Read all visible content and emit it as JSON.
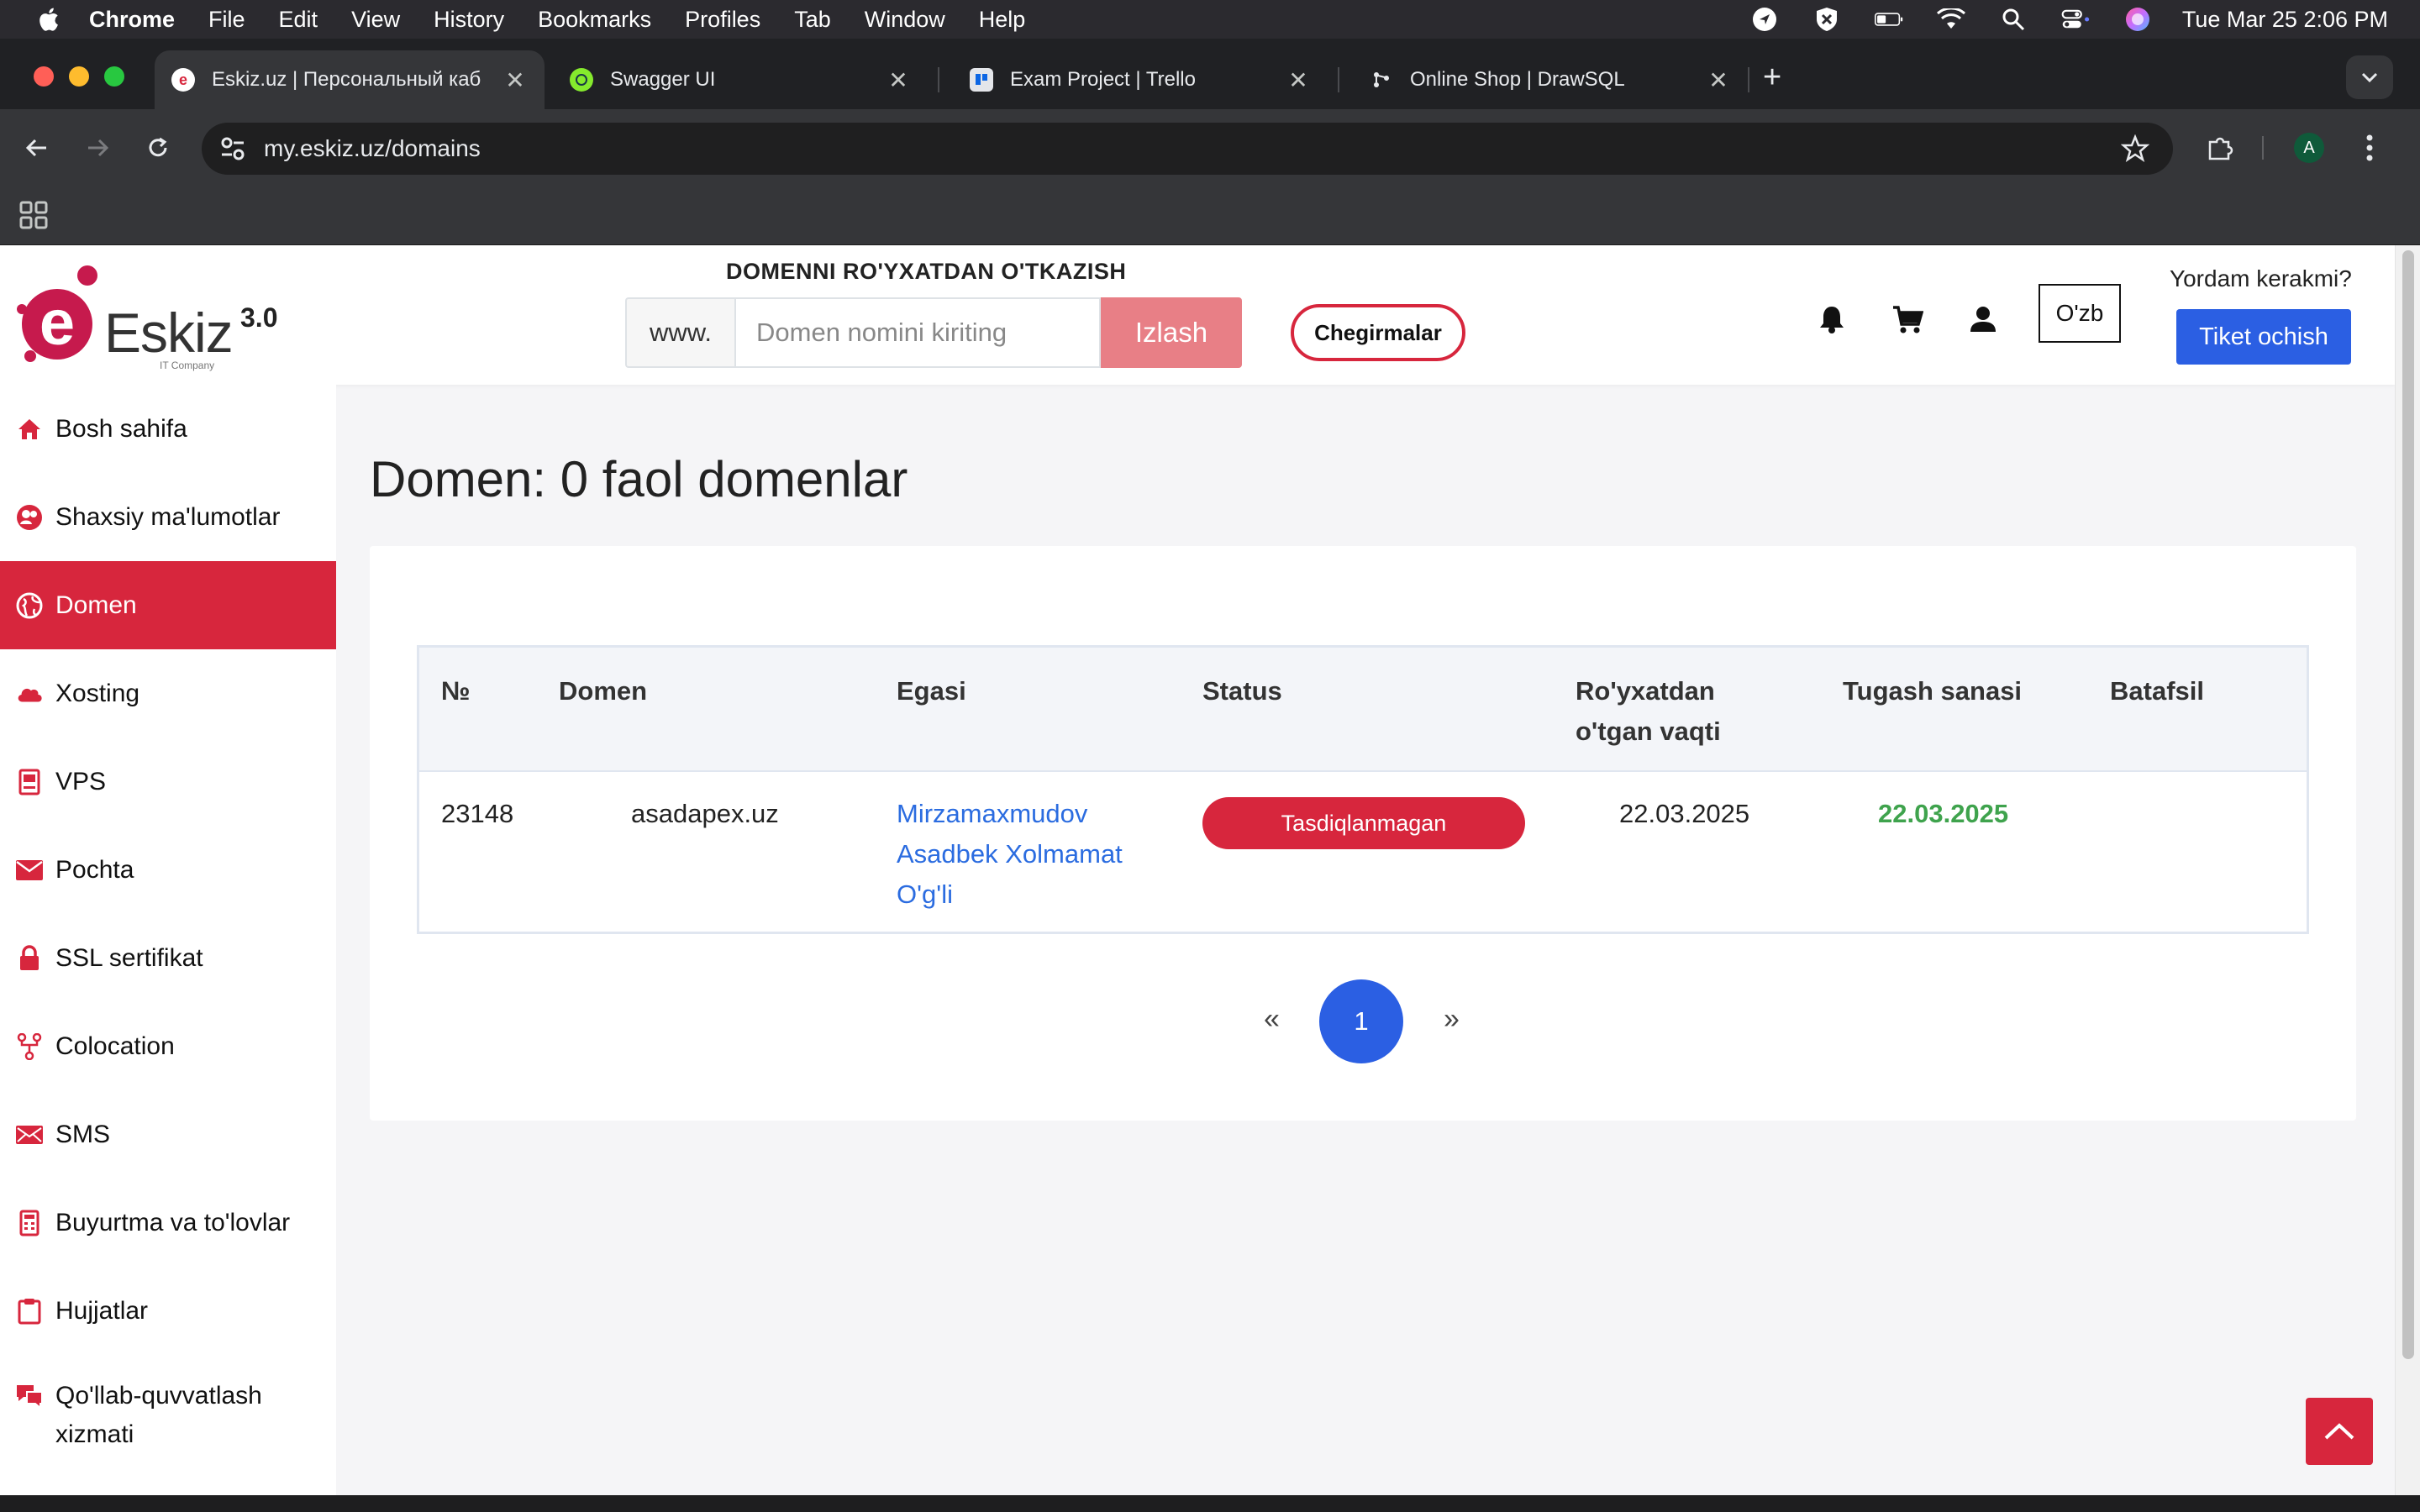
{
  "menubar": {
    "app": "Chrome",
    "items": [
      "File",
      "Edit",
      "View",
      "History",
      "Bookmarks",
      "Profiles",
      "Tab",
      "Window",
      "Help"
    ],
    "clock": "Tue Mar 25  2:06 PM"
  },
  "tabs": [
    {
      "title": "Eskiz.uz | Персональный каб",
      "active": true,
      "favicon": "e"
    },
    {
      "title": "Swagger UI",
      "active": false
    },
    {
      "title": "Exam Project | Trello",
      "active": false
    },
    {
      "title": "Online Shop | DrawSQL",
      "active": false
    }
  ],
  "toolbar": {
    "url": "my.eskiz.uz/domains",
    "profile_initial": "A"
  },
  "header": {
    "logo_text": "Eskiz",
    "logo_version": "3.0",
    "logo_tagline": "IT Company",
    "register_title": "DOMENNI RO'YXATDAN O'TKAZISH",
    "search_prefix": "www.",
    "search_placeholder": "Domen nomini kiriting",
    "search_button": "Izlash",
    "discount_button": "Chegirmalar",
    "language": "O'zb",
    "help_text": "Yordam kerakmi?",
    "ticket_button": "Tiket ochish"
  },
  "sidebar": {
    "items": [
      {
        "label": "Bosh sahifa",
        "icon": "home-icon"
      },
      {
        "label": "Shaxsiy ma'lumotlar",
        "icon": "users-icon"
      },
      {
        "label": "Domen",
        "icon": "globe-icon",
        "active": true
      },
      {
        "label": "Xosting",
        "icon": "cloud-icon"
      },
      {
        "label": "VPS",
        "icon": "server-icon"
      },
      {
        "label": "Pochta",
        "icon": "envelope-icon"
      },
      {
        "label": "SSL sertifikat",
        "icon": "lock-icon"
      },
      {
        "label": "Colocation",
        "icon": "network-icon"
      },
      {
        "label": "SMS",
        "icon": "sms-icon"
      },
      {
        "label": "Buyurtma va to'lovlar",
        "icon": "calculator-icon"
      },
      {
        "label": "Hujjatlar",
        "icon": "clipboard-icon"
      },
      {
        "label": "Qo'llab-quvvatlash xizmati",
        "icon": "chat-icon"
      }
    ]
  },
  "main": {
    "title": "Domen: 0 faol domenlar",
    "table": {
      "columns": [
        "№",
        "Domen",
        "Egasi",
        "Status",
        "Ro'yxatdan o'tgan vaqti",
        "Tugash sanasi",
        "Batafsil"
      ],
      "rows": [
        {
          "id": "23148",
          "domain": "asadapex.uz",
          "owner_lines": [
            "Mirzamaxmudov",
            "Asadbek Xolmamat",
            "O'g'li"
          ],
          "status": "Tasdiqlanmagan",
          "registered": "22.03.2025",
          "expires": "22.03.2025",
          "details": ""
        }
      ]
    },
    "pagination": {
      "prev": "«",
      "current": "1",
      "next": "»"
    }
  },
  "colors": {
    "brand_red": "#d7263d",
    "primary_blue": "#2b5fe3",
    "link_blue": "#2b6ce0",
    "success_green": "#3fa34d"
  }
}
